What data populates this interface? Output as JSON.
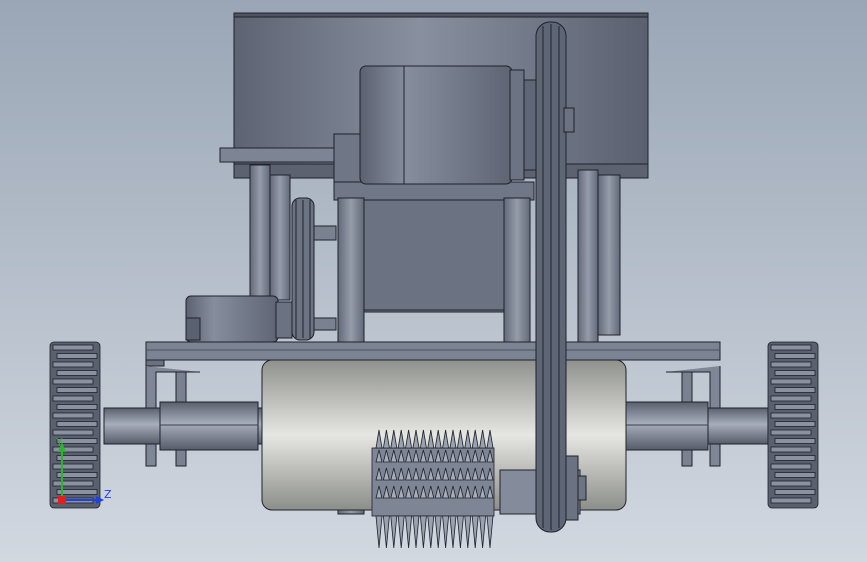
{
  "triad": {
    "x_label": "",
    "y_label": "Y",
    "z_label": "Z",
    "x_color": "#e02020",
    "y_color": "#2ab52a",
    "z_color": "#2040e0"
  },
  "colors": {
    "background_top": "#9aa6b6",
    "background_bottom": "#d0d6df",
    "metal_dark": "#5f6675",
    "metal_mid": "#7d8595",
    "metal_light": "#aab1bf",
    "edge": "#1e222b",
    "drum_light": "#e4e4e0",
    "drum_dark": "#9a9c98"
  }
}
